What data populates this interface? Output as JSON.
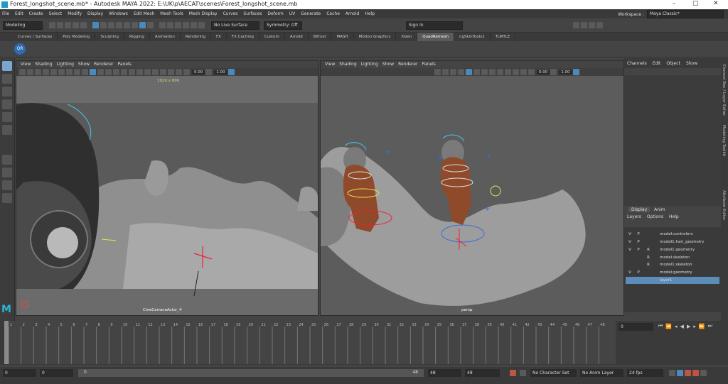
{
  "window": {
    "title": "Forest_longshot_scene.mb* - Autodesk MAYA 2022: E:\\UK\\p\\AECAT\\scenes\\Forest_longshot_scene.mb",
    "controls": [
      "–",
      "▢",
      "✕"
    ]
  },
  "menus": [
    "File",
    "Edit",
    "Create",
    "Select",
    "Modify",
    "Display",
    "Windows",
    "Edit Mesh",
    "Mesh Tools",
    "Mesh Display",
    "Curves",
    "Surfaces",
    "Deform",
    "UV",
    "Generate",
    "Cache",
    "Arnold",
    "Help"
  ],
  "workspace": {
    "label": "Workspace :",
    "value": "Maya Classic*"
  },
  "statusline": {
    "mode": "Modeling",
    "live_surface": "No Live Surface",
    "symmetry": "Symmetry: Off",
    "sign_in": "Sign In"
  },
  "shelf_tabs": [
    "Curves / Surfaces",
    "Poly Modeling",
    "Sculpting",
    "Rigging",
    "Animation",
    "Rendering",
    "FX",
    "FX Caching",
    "Custom",
    "Arnold",
    "Bifrost",
    "MASH",
    "Motion Graphics",
    "XGen",
    "QuadRemesh",
    "ngSkinTools2",
    "TURTLE"
  ],
  "shelf_active": "QuadRemesh",
  "shelf_button": "QR",
  "viewport_menu": [
    "View",
    "Shading",
    "Lighting",
    "Show",
    "Renderer",
    "Panels"
  ],
  "viewport_left": {
    "resolution": "1920 x 800",
    "camera": "CineCameraActor_4",
    "near": "0.00",
    "far": "1.00"
  },
  "viewport_right": {
    "camera": "persp",
    "near": "0.00",
    "far": "1.00"
  },
  "channel_box": {
    "menu": [
      "Channels",
      "Edit",
      "Object",
      "Show"
    ]
  },
  "side_tabs": [
    "Channel Box / Layer Editor",
    "Modeling Toolkit",
    "Attribute Editor"
  ],
  "layer_editor": {
    "tabs": [
      "Display",
      "Anim"
    ],
    "menu": [
      "Layers",
      "Options",
      "Help"
    ],
    "layers": [
      {
        "v": "V",
        "p": "P",
        "r": "",
        "name": "model:controlers",
        "selected": false
      },
      {
        "v": "V",
        "p": "P",
        "r": "",
        "name": "model1:hair_geometry",
        "selected": false
      },
      {
        "v": "V",
        "p": "P",
        "r": "R",
        "name": "model1:geometry",
        "selected": false
      },
      {
        "v": "",
        "p": "",
        "r": "R",
        "name": "model:skeleton",
        "selected": false
      },
      {
        "v": "",
        "p": "",
        "r": "R",
        "name": "model1:skeleton",
        "selected": false
      },
      {
        "v": "V",
        "p": "P",
        "r": "",
        "name": "model:geometry",
        "selected": false
      },
      {
        "v": "",
        "p": "",
        "r": "",
        "name": "layer1",
        "selected": true
      }
    ]
  },
  "timeline": {
    "ticks": [
      "1",
      "2",
      "3",
      "4",
      "5",
      "6",
      "7",
      "8",
      "9",
      "10",
      "11",
      "12",
      "13",
      "14",
      "15",
      "16",
      "17",
      "18",
      "19",
      "20",
      "21",
      "22",
      "23",
      "24",
      "25",
      "26",
      "27",
      "28",
      "29",
      "30",
      "31",
      "32",
      "33",
      "34",
      "35",
      "36",
      "37",
      "38",
      "39",
      "40",
      "41",
      "42",
      "43",
      "44",
      "45",
      "46",
      "47",
      "48"
    ],
    "current_frame": "0"
  },
  "range": {
    "start": "0",
    "anim_start": "0",
    "range_start_label": "0",
    "range_end_label": "48",
    "range_end": "48",
    "anim_end": "48",
    "character_set": "No Character Set",
    "anim_layer": "No Anim Layer",
    "fps": "24 fps"
  },
  "colors": {
    "accent": "#4d89b8",
    "selected_layer": "#5b8db8",
    "maya_logo": "#2ab3d4"
  }
}
